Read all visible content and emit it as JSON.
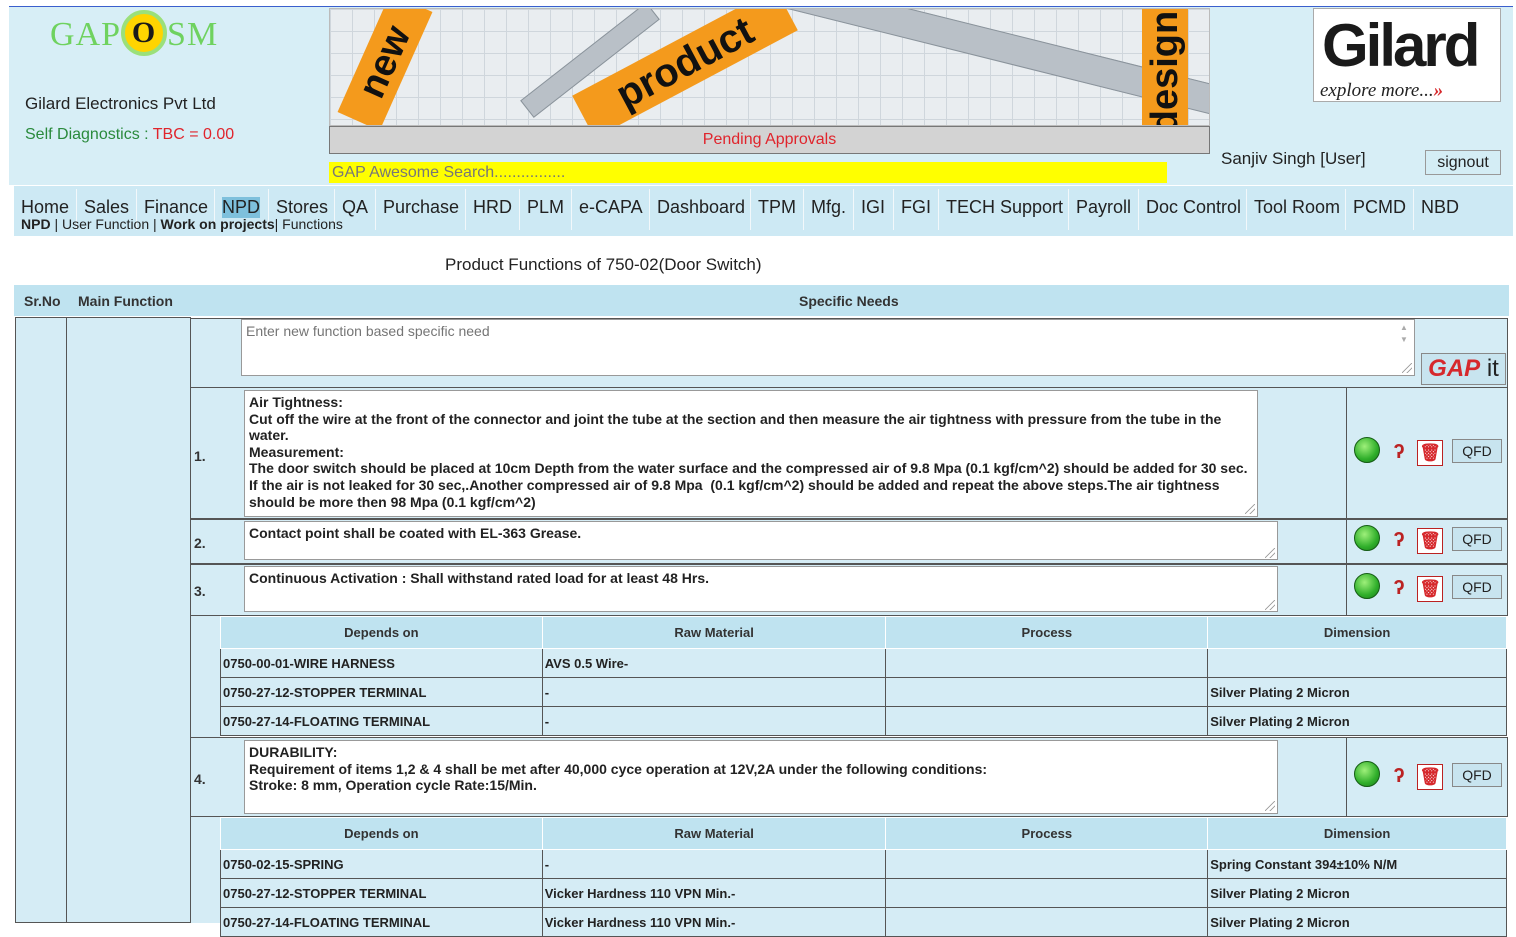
{
  "header": {
    "logo_left": "GAP",
    "logo_o": "O",
    "logo_right": "SM",
    "company": "Gilard Electronics Pvt Ltd",
    "self_diag_label": "Self Diagnostics : ",
    "self_diag_value": "TBC = 0.00",
    "banner_words": [
      "new",
      "product",
      "design"
    ],
    "pending": "Pending Approvals",
    "search_value": "GAP Awesome Search................",
    "brand": "Gilard",
    "brand_tagline": "explore more...",
    "user": "Sanjiv Singh [User]",
    "signout": "signout"
  },
  "nav": {
    "items": [
      "Home",
      "Sales",
      "Finance",
      "NPD",
      "Stores",
      "QA",
      "Purchase",
      "HRD",
      "PLM",
      "e-CAPA",
      "Dashboard",
      "TPM",
      "Mfg.",
      "IGI",
      "FGI",
      "TECH Support",
      "Payroll",
      "Doc Control",
      "Tool Room",
      "PCMD",
      "NBD"
    ],
    "active": "NPD",
    "sub_npd": "NPD",
    "sub_user_function": " | User Function | ",
    "sub_work": "Work on projects",
    "sub_functions": "| Functions"
  },
  "page": {
    "title": "Product Functions of 750-02(Door Switch)",
    "col_srno": "Sr.No",
    "col_main": "Main Function",
    "col_specific": "Specific Needs",
    "new_placeholder": "Enter new function based specific need",
    "gap_label": "GAP",
    "gap_it": " it",
    "qfd": "QFD"
  },
  "functions": [
    {
      "num": "1.",
      "text": "Air Tightness:\nCut off the wire at the front of the connector and joint the tube at the section and then measure the air tightness with pressure from the tube in the water.\nMeasurement:\nThe door switch should be placed at 10cm Depth from the water surface and the compressed air of 9.8 Mpa (0.1 kgf/cm^2) should be added for 30 sec. If the air is not leaked for 30 sec,.Another compressed air of 9.8 Mpa  (0.1 kgf/cm^2) should be added and repeat the above steps.The air tightness should be more then 98 Mpa (0.1 kgf/cm^2)"
    },
    {
      "num": "2.",
      "text": "Contact point shall be coated with EL-363 Grease."
    },
    {
      "num": "3.",
      "text": "Continuous Activation : Shall withstand rated load for at least 48 Hrs."
    },
    {
      "num": "4.",
      "text": "DURABILITY:\nRequirement of items 1,2 & 4 shall be met after 40,000 cyce operation at 12V,2A under the following conditions:\nStroke: 8 mm, Operation cycle Rate:15/Min."
    }
  ],
  "depends_headers": [
    "Depends on",
    "Raw Material",
    "Process",
    "Dimension"
  ],
  "depends_3": [
    [
      "0750-00-01-WIRE HARNESS",
      "AVS 0.5 Wire-",
      "",
      ""
    ],
    [
      "0750-27-12-STOPPER TERMINAL",
      "-",
      "",
      "Silver Plating 2 Micron"
    ],
    [
      "0750-27-14-FLOATING TERMINAL",
      "-",
      "",
      "Silver Plating 2 Micron"
    ]
  ],
  "depends_4": [
    [
      "0750-02-15-SPRING",
      "-",
      "",
      "Spring Constant 394±10% N/M"
    ],
    [
      "0750-27-12-STOPPER TERMINAL",
      "Vicker Hardness 110 VPN Min.-",
      "",
      "Silver Plating 2 Micron"
    ],
    [
      "0750-27-14-FLOATING TERMINAL",
      "Vicker Hardness 110 VPN Min.-",
      "",
      "Silver Plating 2 Micron"
    ]
  ],
  "colors": {
    "header_bg": "#d7eef6",
    "nav_active": "#7ec0dc",
    "search_bg": "#ffff00",
    "pending_text": "#e0242c",
    "banner_stripe": "#f49a1c"
  }
}
